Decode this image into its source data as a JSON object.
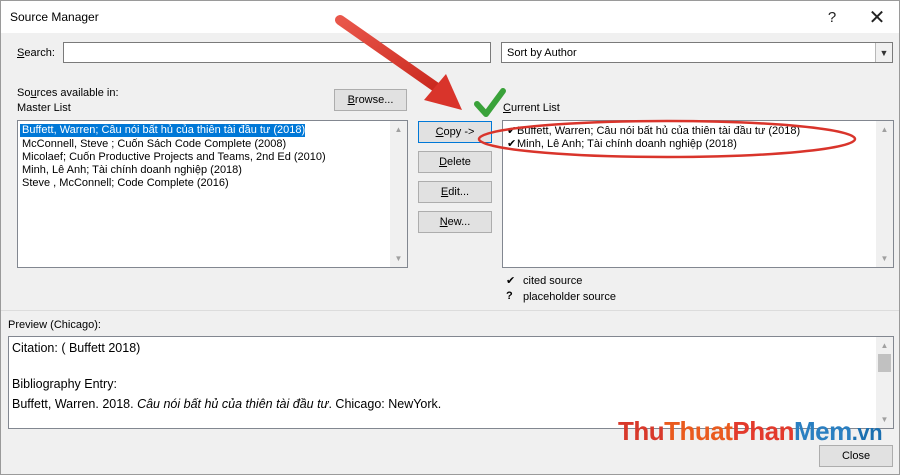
{
  "window": {
    "title": "Source Manager",
    "help_glyph": "?",
    "close_glyph": "✕"
  },
  "search": {
    "label_first": "S",
    "label_rest": "earch:",
    "value": "",
    "placeholder": ""
  },
  "sort": {
    "selected": "Sort by Author",
    "arrow": "▼"
  },
  "sources_available": {
    "label_pre": "So",
    "label_acc": "u",
    "label_post": "rces available in:",
    "list_name": "Master List",
    "browse_label_pre": "",
    "browse_label_acc": "B",
    "browse_label_post": "rowse..."
  },
  "master_list": [
    "Buffett, Warren; Câu nói bất hủ của thiên tài đầu tư (2018)",
    "McConnell, Steve ; Cuốn Sách Code Complete (2008)",
    "Micolaef; Cuốn Productive Projects and Teams, 2nd Ed (2010)",
    "Minh, Lê  Anh; Tài chính doanh nghiệp  (2018)",
    "Steve , McConnell; Code Complete (2016)"
  ],
  "actions": {
    "copy_acc": "C",
    "copy_rest": "opy ->",
    "delete_acc": "D",
    "delete_rest": "elete",
    "edit_acc": "E",
    "edit_rest": "dit...",
    "new_acc": "N",
    "new_rest": "ew..."
  },
  "current": {
    "label_acc": "C",
    "label_rest": "urrent List",
    "check_glyph": "✔",
    "items": [
      "Buffett, Warren; Câu nói bất hủ của thiên tài đầu tư (2018)",
      "Minh, Lê  Anh; Tài chính doanh nghiệp  (2018)"
    ]
  },
  "legend": {
    "cited_mark": "✔",
    "cited_label": "cited source",
    "placeholder_mark": "?",
    "placeholder_label": "placeholder source"
  },
  "preview": {
    "label": "Preview (Chicago):",
    "citation": "Citation:  ( Buffett 2018)",
    "bib_heading": "Bibliography Entry:",
    "bib_author": "Buffett, Warren. 2018. ",
    "bib_title": "Câu nói bất hủ của thiên tài đầu tư",
    "bib_tail": ". Chicago: NewYork."
  },
  "close_button": "Close",
  "watermark": {
    "part1": "Thu",
    "part2": "Thuat",
    "part3": "Phan",
    "part4": "Mem",
    "part5": ".vn"
  },
  "colors": {
    "selection": "#0078d7",
    "annotation_red": "#d9342b",
    "check_green": "#3aa23a"
  }
}
